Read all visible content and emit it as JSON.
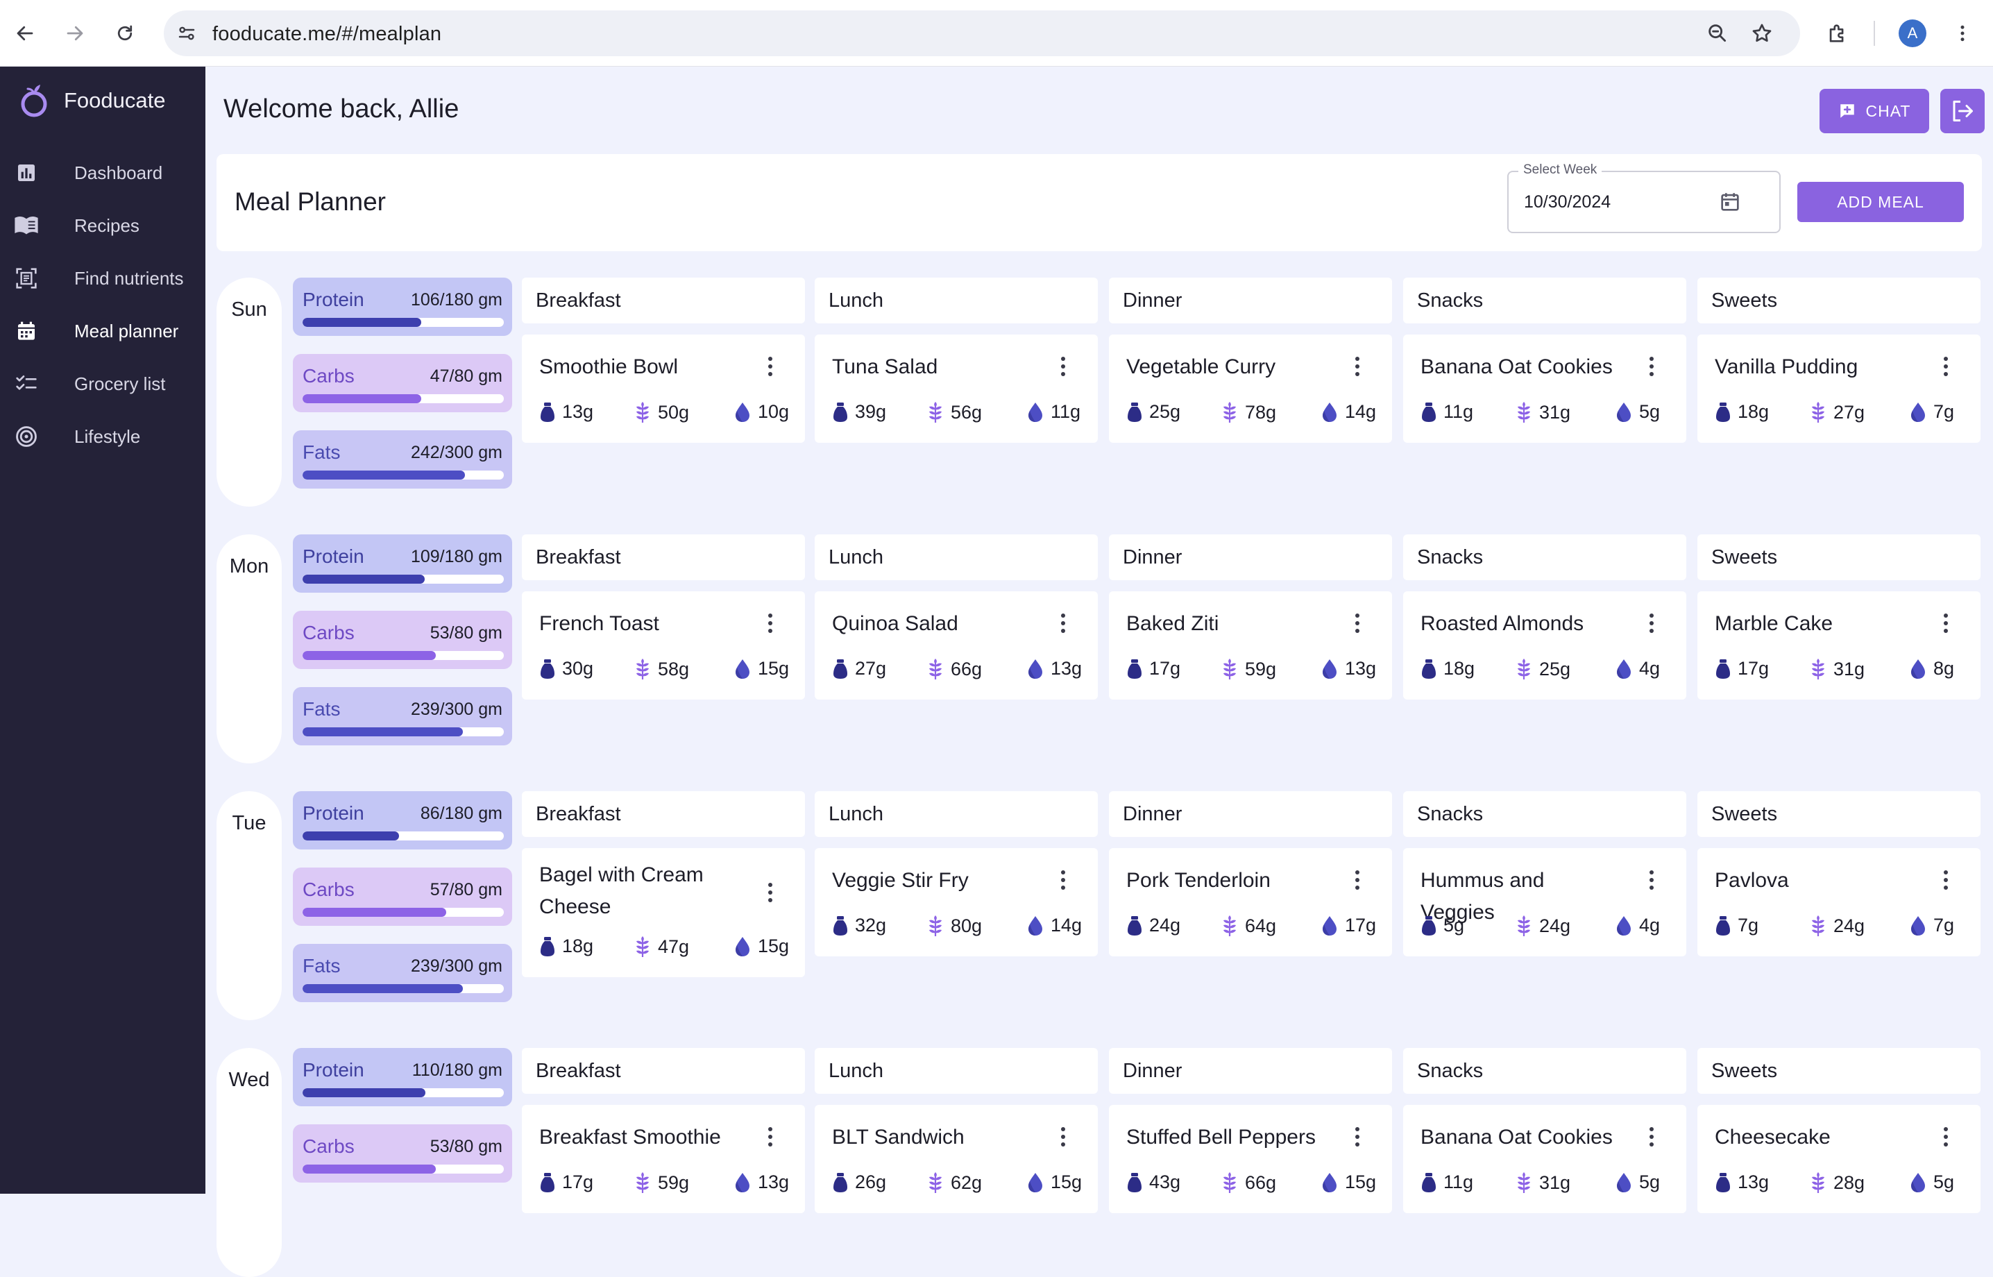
{
  "browser": {
    "url": "fooducate.me/#/mealplan",
    "avatar_letter": "A"
  },
  "sidebar": {
    "brand": "Fooducate",
    "items": [
      {
        "label": "Dashboard",
        "icon": "bar-chart-icon"
      },
      {
        "label": "Recipes",
        "icon": "book-icon"
      },
      {
        "label": "Find nutrients",
        "icon": "scan-document-icon"
      },
      {
        "label": "Meal planner",
        "icon": "calendar-icon"
      },
      {
        "label": "Grocery list",
        "icon": "checklist-icon"
      },
      {
        "label": "Lifestyle",
        "icon": "target-icon"
      }
    ]
  },
  "header": {
    "welcome": "Welcome back, Allie",
    "chat_label": "CHAT"
  },
  "planner": {
    "title": "Meal Planner",
    "week_label": "Select Week",
    "week_value": "10/30/2024",
    "add_meal_label": "ADD MEAL"
  },
  "columns": [
    "Breakfast",
    "Lunch",
    "Dinner",
    "Snacks",
    "Sweets"
  ],
  "colors": {
    "accent": "#8a63e0",
    "sidebar": "#242238",
    "protein": "#3d3fae",
    "carbs": "#8d63e6",
    "fats": "#4d4ec4"
  },
  "days": [
    {
      "day": "Sun",
      "macros": [
        {
          "label": "Protein",
          "value": "106/180 gm",
          "fraction": 0.589
        },
        {
          "label": "Carbs",
          "value": "47/80 gm",
          "fraction": 0.588
        },
        {
          "label": "Fats",
          "value": "242/300 gm",
          "fraction": 0.807
        }
      ],
      "meals": [
        {
          "name": "Smoothie Bowl",
          "protein": "13g",
          "carbs": "50g",
          "fat": "10g"
        },
        {
          "name": "Tuna Salad",
          "protein": "39g",
          "carbs": "56g",
          "fat": "11g"
        },
        {
          "name": "Vegetable Curry",
          "protein": "25g",
          "carbs": "78g",
          "fat": "14g"
        },
        {
          "name": "Banana Oat Cookies",
          "protein": "11g",
          "carbs": "31g",
          "fat": "5g"
        },
        {
          "name": "Vanilla Pudding",
          "protein": "18g",
          "carbs": "27g",
          "fat": "7g"
        }
      ]
    },
    {
      "day": "Mon",
      "macros": [
        {
          "label": "Protein",
          "value": "109/180 gm",
          "fraction": 0.606
        },
        {
          "label": "Carbs",
          "value": "53/80 gm",
          "fraction": 0.663
        },
        {
          "label": "Fats",
          "value": "239/300 gm",
          "fraction": 0.797
        }
      ],
      "meals": [
        {
          "name": "French Toast",
          "protein": "30g",
          "carbs": "58g",
          "fat": "15g"
        },
        {
          "name": "Quinoa Salad",
          "protein": "27g",
          "carbs": "66g",
          "fat": "13g"
        },
        {
          "name": "Baked Ziti",
          "protein": "17g",
          "carbs": "59g",
          "fat": "13g"
        },
        {
          "name": "Roasted Almonds",
          "protein": "18g",
          "carbs": "25g",
          "fat": "4g"
        },
        {
          "name": "Marble Cake",
          "protein": "17g",
          "carbs": "31g",
          "fat": "8g"
        }
      ]
    },
    {
      "day": "Tue",
      "macros": [
        {
          "label": "Protein",
          "value": "86/180 gm",
          "fraction": 0.478
        },
        {
          "label": "Carbs",
          "value": "57/80 gm",
          "fraction": 0.713
        },
        {
          "label": "Fats",
          "value": "239/300 gm",
          "fraction": 0.797
        }
      ],
      "meals": [
        {
          "name": "Bagel with Cream Cheese",
          "protein": "18g",
          "carbs": "47g",
          "fat": "15g"
        },
        {
          "name": "Veggie Stir Fry",
          "protein": "32g",
          "carbs": "80g",
          "fat": "14g"
        },
        {
          "name": "Pork Tenderloin",
          "protein": "24g",
          "carbs": "64g",
          "fat": "17g"
        },
        {
          "name": "Hummus and Veggies",
          "protein": "5g",
          "carbs": "24g",
          "fat": "4g"
        },
        {
          "name": "Pavlova",
          "protein": "7g",
          "carbs": "24g",
          "fat": "7g"
        }
      ]
    },
    {
      "day": "Wed",
      "macros": [
        {
          "label": "Protein",
          "value": "110/180 gm",
          "fraction": 0.611
        },
        {
          "label": "Carbs",
          "value": "53/80 gm",
          "fraction": 0.663
        }
      ],
      "meals": [
        {
          "name": "Breakfast Smoothie",
          "protein": "17g",
          "carbs": "59g",
          "fat": "13g"
        },
        {
          "name": "BLT Sandwich",
          "protein": "26g",
          "carbs": "62g",
          "fat": "15g"
        },
        {
          "name": "Stuffed Bell Peppers",
          "protein": "43g",
          "carbs": "66g",
          "fat": "15g"
        },
        {
          "name": "Banana Oat Cookies",
          "protein": "11g",
          "carbs": "31g",
          "fat": "5g"
        },
        {
          "name": "Cheesecake",
          "protein": "13g",
          "carbs": "28g",
          "fat": "5g"
        }
      ]
    }
  ]
}
